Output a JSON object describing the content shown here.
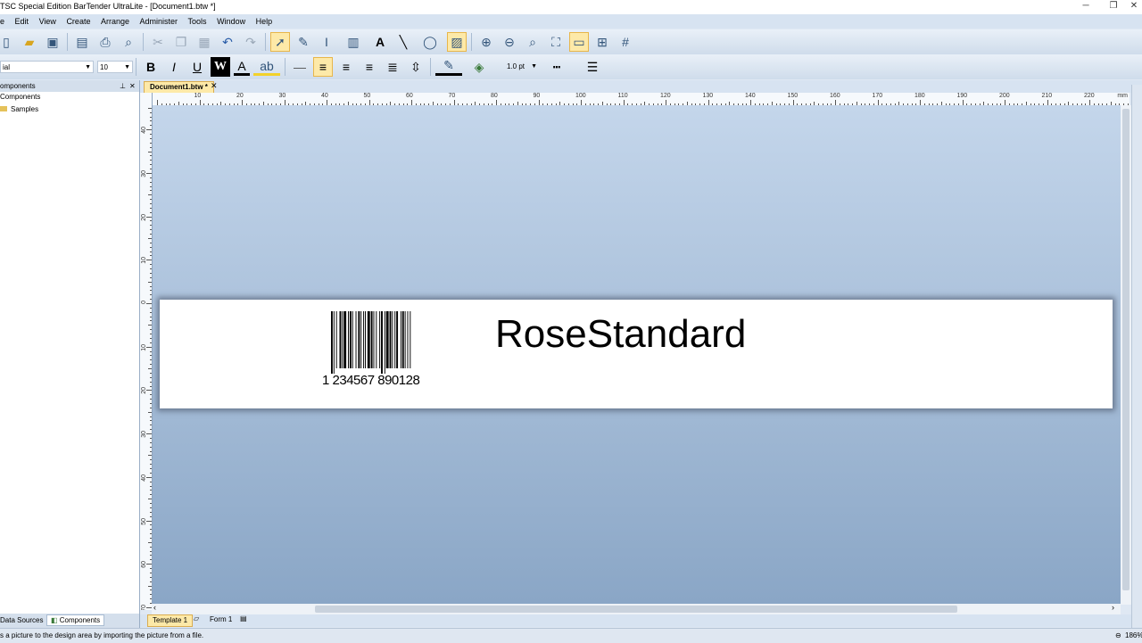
{
  "window": {
    "title": "TSC Special Edition BarTender UltraLite - [Document1.btw *]",
    "controls": [
      "─",
      "❐",
      "✕"
    ]
  },
  "menu": [
    "e",
    "Edit",
    "View",
    "Create",
    "Arrange",
    "Administer",
    "Tools",
    "Window",
    "Help"
  ],
  "toolbar": {
    "font_name": "ial",
    "font_size": "10",
    "line_width": "1.0 pt",
    "bold": "B",
    "italic": "I",
    "underline": "U",
    "wordart": "W",
    "text_tool": "A"
  },
  "left_panel": {
    "title": "omponents",
    "tree_root": "Components",
    "tree_child": "Samples",
    "tabs": [
      "Data Sources",
      "Components"
    ]
  },
  "document": {
    "tab_label": "Document1.btw *",
    "ruler_unit": "mm",
    "hruler_labels": [
      "10",
      "20",
      "30",
      "40",
      "50",
      "60",
      "70",
      "80",
      "90",
      "100",
      "110",
      "120",
      "130",
      "140",
      "150",
      "160",
      "170",
      "180",
      "190",
      "200",
      "210",
      "220"
    ],
    "vruler_labels": [
      "40",
      "30",
      "20",
      "10",
      "0",
      "10",
      "20",
      "30",
      "40",
      "50",
      "60",
      "70"
    ]
  },
  "label": {
    "barcode_number": "1 234567 890128",
    "text": "RoseStandard"
  },
  "sheet_tabs": [
    "Template 1",
    "Form 1"
  ],
  "status": {
    "message": "s a picture to the design area by importing the picture from a file.",
    "zoom": "186%"
  },
  "colors": {
    "active_tool": "#fde9a8",
    "canvas_top": "#c4d6eb",
    "canvas_bottom": "#8aa6c6"
  }
}
